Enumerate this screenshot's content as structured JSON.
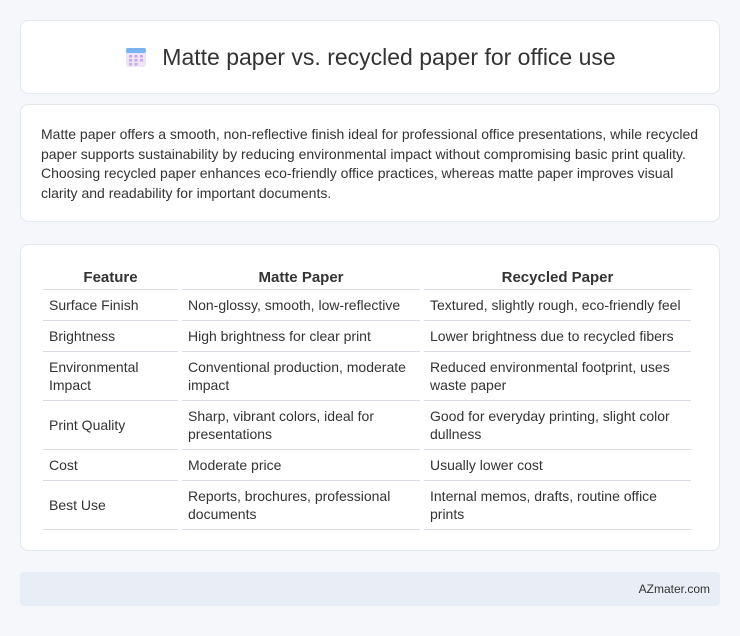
{
  "header": {
    "title": "Matte paper vs. recycled paper for office use",
    "icon": "calendar-icon"
  },
  "intro": {
    "text": "Matte paper offers a smooth, non-reflective finish ideal for professional office presentations, while recycled paper supports sustainability by reducing environmental impact without compromising basic print quality. Choosing recycled paper enhances eco-friendly office practices, whereas matte paper improves visual clarity and readability for important documents."
  },
  "table": {
    "headers": [
      "Feature",
      "Matte Paper",
      "Recycled Paper"
    ],
    "rows": [
      [
        "Surface Finish",
        "Non-glossy, smooth, low-reflective",
        "Textured, slightly rough, eco-friendly feel"
      ],
      [
        "Brightness",
        "High brightness for clear print",
        "Lower brightness due to recycled fibers"
      ],
      [
        "Environmental Impact",
        "Conventional production, moderate impact",
        "Reduced environmental footprint, uses waste paper"
      ],
      [
        "Print Quality",
        "Sharp, vibrant colors, ideal for presentations",
        "Good for everyday printing, slight color dullness"
      ],
      [
        "Cost",
        "Moderate price",
        "Usually lower cost"
      ],
      [
        "Best Use",
        "Reports, brochures, professional documents",
        "Internal memos, drafts, routine office prints"
      ]
    ]
  },
  "footer": {
    "text": "AZmater.com"
  }
}
